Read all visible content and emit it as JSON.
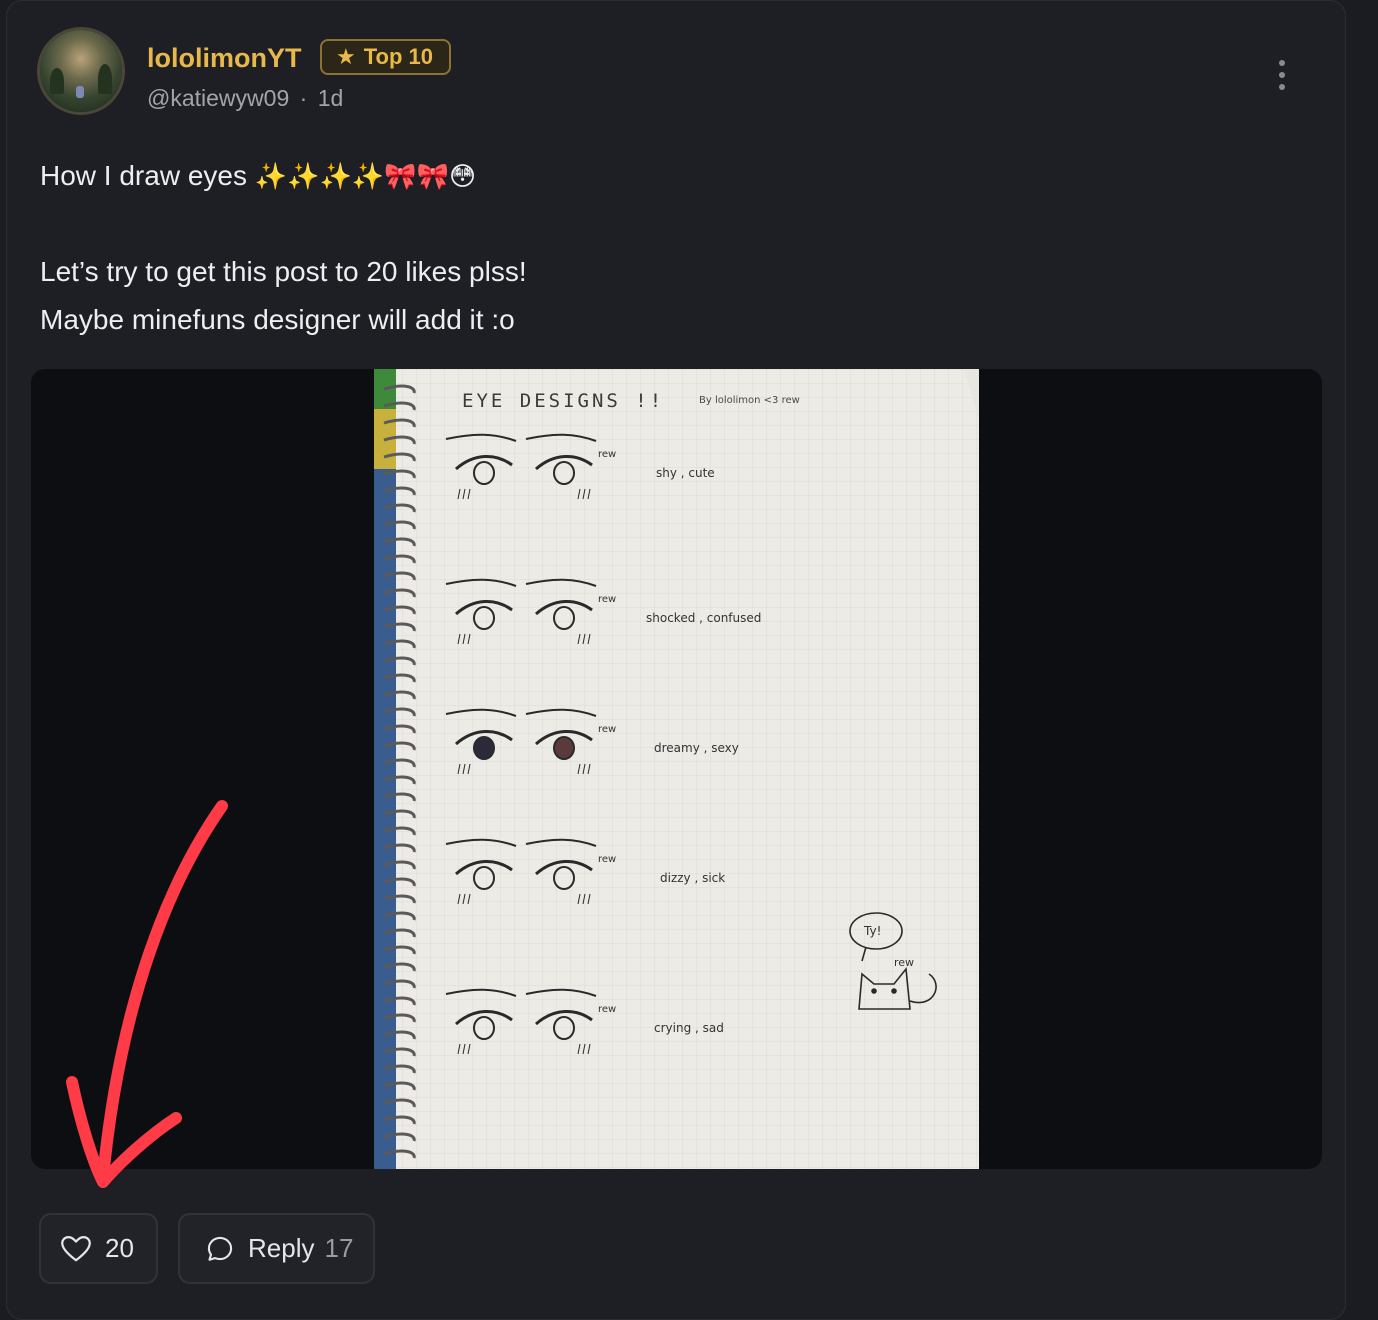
{
  "post": {
    "author_name": "lololimonYT",
    "badge_label": "Top 10",
    "handle": "@katiewyw09",
    "separator": "·",
    "time": "1d",
    "text_line1": "How I draw eyes",
    "text_line1_emoji": "✨✨✨✨🎀🎀😳",
    "text_line2": "Let’s try to get this post to 20 likes plss!",
    "text_line3": "Maybe minefuns designer will add it :o"
  },
  "image": {
    "title": "EYE DESIGNS !!",
    "byline": "By lololimon <3 rew",
    "rows": [
      {
        "label": "shy , cute"
      },
      {
        "label": "shocked , confused"
      },
      {
        "label": "dreamy , sexy"
      },
      {
        "label": "dizzy , sick"
      },
      {
        "label": "crying , sad"
      }
    ],
    "signature": "rew",
    "speech_bubble": "Ty!"
  },
  "actions": {
    "like_count": "20",
    "reply_label": "Reply",
    "reply_count": "17"
  },
  "colors": {
    "background": "#1e1f24",
    "username": "#e8b84a",
    "badge_border": "#8d7333",
    "annotation_arrow": "#ff3b47"
  },
  "icons": [
    "more-vertical-icon",
    "star-icon",
    "heart-icon",
    "comment-icon"
  ]
}
